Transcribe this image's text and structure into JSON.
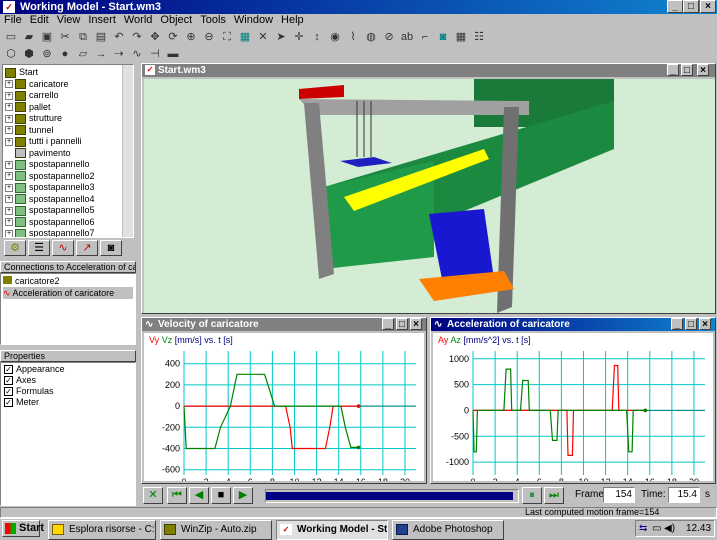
{
  "app": {
    "title": "Working Model - Start.wm3",
    "menu": [
      "File",
      "Edit",
      "View",
      "Insert",
      "World",
      "Object",
      "Tools",
      "Window",
      "Help"
    ]
  },
  "tree": {
    "items": [
      {
        "label": "Start",
        "type": "root"
      },
      {
        "label": "caricatore",
        "type": "group"
      },
      {
        "label": "carrello",
        "type": "group"
      },
      {
        "label": "pallet",
        "type": "group"
      },
      {
        "label": "strutture",
        "type": "group"
      },
      {
        "label": "tunnel",
        "type": "group"
      },
      {
        "label": "tutti i pannelli",
        "type": "group"
      },
      {
        "label": "pavimento",
        "type": "leaf"
      },
      {
        "label": "spostapannello",
        "type": "motor"
      },
      {
        "label": "spostapannello2",
        "type": "motor"
      },
      {
        "label": "spostapannello3",
        "type": "motor"
      },
      {
        "label": "spostapannello4",
        "type": "motor"
      },
      {
        "label": "spostapannello5",
        "type": "motor"
      },
      {
        "label": "spostapannello6",
        "type": "motor"
      },
      {
        "label": "spostapannello7",
        "type": "motor"
      }
    ]
  },
  "connections": {
    "header": "Connections to Acceleration of caric...",
    "items": [
      "caricatore2",
      "Acceleration of caricatore"
    ]
  },
  "properties": {
    "header": "Properties",
    "items": [
      "Appearance",
      "Axes",
      "Formulas",
      "Meter"
    ]
  },
  "scene": {
    "title": "Start.wm3"
  },
  "velocity": {
    "title": "Velocity of caricatore",
    "legend_vy": "Vy",
    "legend_vz": "Vz",
    "legend_rest": "[mm/s] vs. t [s]"
  },
  "accel": {
    "title": "Acceleration of caricatore",
    "legend_ay": "Ay",
    "legend_az": "Az",
    "legend_rest": "[mm/s^2] vs. t [s]"
  },
  "chart_data": [
    {
      "type": "line",
      "title": "Velocity of caricatore",
      "xlabel": "t [s]",
      "ylabel": "[mm/s]",
      "xlim": [
        0,
        21
      ],
      "ylim": [
        -650,
        520
      ],
      "xticks": [
        0,
        2,
        4,
        6,
        8,
        10,
        12,
        14,
        16,
        18,
        20
      ],
      "yticks": [
        400,
        200,
        0,
        -200,
        -400,
        -600
      ],
      "series": [
        {
          "name": "Vy",
          "color": "#ff0000",
          "points": [
            [
              0,
              0
            ],
            [
              4.2,
              0
            ],
            [
              8,
              0
            ],
            [
              9.2,
              0
            ],
            [
              9.6,
              -200
            ],
            [
              9.8,
              -400
            ],
            [
              12.8,
              -400
            ],
            [
              13.2,
              -200
            ],
            [
              13.5,
              0
            ],
            [
              15.8,
              0
            ]
          ]
        },
        {
          "name": "Vz",
          "color": "#008000",
          "points": [
            [
              0,
              0
            ],
            [
              0.2,
              -400
            ],
            [
              2.8,
              -400
            ],
            [
              3.3,
              -200
            ],
            [
              4.2,
              0
            ],
            [
              4.8,
              300
            ],
            [
              7.3,
              300
            ],
            [
              8.2,
              0
            ],
            [
              14.2,
              0
            ],
            [
              14.6,
              -200
            ],
            [
              15.1,
              -390
            ],
            [
              15.8,
              -390
            ]
          ]
        }
      ]
    },
    {
      "type": "line",
      "title": "Acceleration of caricatore",
      "xlabel": "t [s]",
      "ylabel": "[mm/s^2]",
      "xlim": [
        0,
        21
      ],
      "ylim": [
        -1250,
        1150
      ],
      "xticks": [
        0,
        2,
        4,
        6,
        8,
        10,
        12,
        14,
        16,
        18,
        20
      ],
      "yticks": [
        1000,
        500,
        0,
        -500,
        -1000
      ],
      "series": [
        {
          "name": "Ay",
          "color": "#ff0000",
          "points": [
            [
              0,
              0
            ],
            [
              8.5,
              0
            ],
            [
              8.6,
              -870
            ],
            [
              9.0,
              -870
            ],
            [
              9.1,
              0
            ],
            [
              12.6,
              0
            ],
            [
              12.8,
              870
            ],
            [
              13.1,
              870
            ],
            [
              13.2,
              0
            ],
            [
              15.6,
              0
            ]
          ]
        },
        {
          "name": "Az",
          "color": "#008000",
          "points": [
            [
              0,
              0
            ],
            [
              0.1,
              -800
            ],
            [
              0.3,
              -800
            ],
            [
              0.4,
              0
            ],
            [
              2.8,
              0
            ],
            [
              3.0,
              800
            ],
            [
              3.4,
              800
            ],
            [
              3.5,
              0
            ],
            [
              4.3,
              0
            ],
            [
              4.5,
              580
            ],
            [
              5.0,
              580
            ],
            [
              5.1,
              0
            ],
            [
              7.0,
              0
            ],
            [
              7.2,
              -580
            ],
            [
              7.6,
              -580
            ],
            [
              7.7,
              0
            ],
            [
              13.9,
              0
            ],
            [
              14.1,
              -800
            ],
            [
              14.4,
              -800
            ],
            [
              14.5,
              0
            ],
            [
              15.6,
              0
            ]
          ]
        }
      ]
    }
  ],
  "playback": {
    "frame_label": "Frame:",
    "frame_value": "154",
    "time_label": "Time:",
    "time_value": "15.4",
    "time_unit": "s",
    "progress": 0.98
  },
  "status": {
    "text": "Last computed motion frame=154"
  },
  "taskbar": {
    "start": "Start",
    "tasks": [
      "Esplora risorse - C:\\Docum...",
      "WinZip - Auto.zip",
      "Working Model - Star...",
      "Adobe Photoshop"
    ],
    "clock": "12.43"
  }
}
